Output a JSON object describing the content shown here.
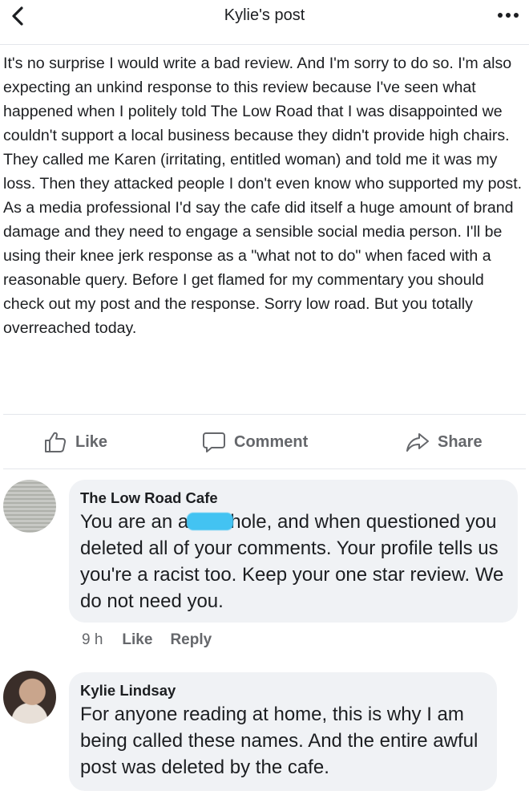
{
  "header": {
    "title": "Kylie's post",
    "back_icon": "chevron-left-icon",
    "more_icon": "more-dots-icon"
  },
  "post": {
    "text": "It's no surprise I would write a bad review. And I'm sorry to do so. I'm also expecting an unkind response to this review because I've seen what happened when I politely told The Low Road that I was disappointed we couldn't support a local business because they didn't provide high chairs. They called me Karen (irritating, entitled woman) and told me it was my loss. Then they attacked people I don't even know who supported my post. As a media professional I'd say the cafe did itself a huge amount of brand damage and they need to engage a sensible social media person. I'll be using their knee jerk response as a \"what not to do\" when faced with a reasonable query. Before I get flamed for my commentary you should check out my post and the response. Sorry low road. But you totally overreached today."
  },
  "actions": {
    "like_label": "Like",
    "comment_label": "Comment",
    "share_label": "Share"
  },
  "comments": [
    {
      "author": "The Low Road Cafe",
      "text_before": "You are an a",
      "text_after": "hole, and when questioned you deleted all of your comments. Your profile tells us you're a racist too. Keep your one star review. We do not need you.",
      "time": "9 h",
      "like_label": "Like",
      "reply_label": "Reply"
    },
    {
      "author": "Kylie Lindsay",
      "text": "For anyone reading at home, this is why I am being called these names. And the entire awful post was deleted by the cafe."
    }
  ],
  "colors": {
    "text": "#1c1e21",
    "secondary": "#65676b",
    "bubble": "#f0f2f5",
    "redaction": "#43c3f2"
  }
}
